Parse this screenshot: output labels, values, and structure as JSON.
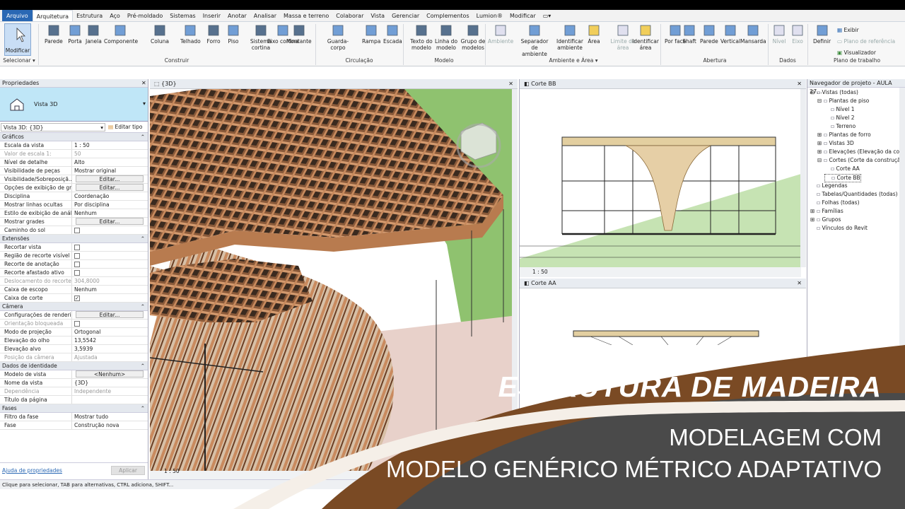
{
  "menu": {
    "tabs": [
      "Arquivo",
      "Arquitetura",
      "Estrutura",
      "Aço",
      "Pré-moldado",
      "Sistemas",
      "Inserir",
      "Anotar",
      "Analisar",
      "Massa e terreno",
      "Colaborar",
      "Vista",
      "Gerenciar",
      "Complementos",
      "Lumion®",
      "Modificar"
    ],
    "extra_icon": "view-dropdown-icon"
  },
  "ribbon": {
    "selecionar_group": "Selecionar ▾",
    "modificar": "Modificar",
    "construir_group": "Construir",
    "construir": [
      "Parede",
      "Porta",
      "Janela",
      "Componente",
      "Coluna",
      "Telhado",
      "Forro",
      "Piso",
      "Sistema cortina",
      "Eixo cortina",
      "Montante"
    ],
    "circulacao_group": "Circulação",
    "circulacao": [
      "Guarda-corpo",
      "Rampa",
      "Escada"
    ],
    "modelo_group": "Modelo",
    "modelo": [
      "Texto do modelo",
      "Linha do modelo",
      "Grupo de modelos"
    ],
    "ambiente_group": "Ambiente e Área ▾",
    "ambiente": [
      "Ambiente",
      "Separador de ambiente",
      "Identificar ambiente",
      "Área",
      "Limite de área",
      "Identificar área"
    ],
    "abertura_group": "Abertura",
    "abertura": [
      "Por face",
      "Shaft",
      "Parede",
      "Vertical",
      "Mansarda"
    ],
    "dados_group": "Dados",
    "dados": [
      "Nível",
      "Eixo"
    ],
    "plano_group": "Plano de trabalho",
    "definir": "Definir",
    "plano_side": [
      "Exibir",
      "Plano de referência",
      "Visualizador"
    ]
  },
  "properties": {
    "header": "Propriedades",
    "type_name": "Vista 3D",
    "selector": "Vista 3D: {3D}",
    "edit_type": "Editar tipo",
    "sections": {
      "graficos": "Gráficos",
      "extensoes": "Extensões",
      "camera": "Câmera",
      "identidade": "Dados de identidade",
      "fases": "Fases"
    },
    "graficos": [
      {
        "k": "Escala da vista",
        "v": "1 : 50"
      },
      {
        "k": "Valor de escala    1:",
        "v": "50"
      },
      {
        "k": "Nível de detalhe",
        "v": "Alto"
      },
      {
        "k": "Visibilidade de peças",
        "v": "Mostrar original"
      },
      {
        "k": "Visibilidade/Sobreposiçã...",
        "v": "Editar..."
      },
      {
        "k": "Opções de exibição de gr...",
        "v": "Editar..."
      },
      {
        "k": "Disciplina",
        "v": "Coordenação"
      },
      {
        "k": "Mostrar linhas ocultas",
        "v": "Por disciplina"
      },
      {
        "k": "Estilo de exibição de anál...",
        "v": "Nenhum"
      },
      {
        "k": "Mostrar grades",
        "v": "Editar..."
      },
      {
        "k": "Caminho do sol",
        "v": ""
      }
    ],
    "extensoes": [
      {
        "k": "Recortar vista",
        "v": ""
      },
      {
        "k": "Região de recorte visível",
        "v": ""
      },
      {
        "k": "Recorte de anotação",
        "v": ""
      },
      {
        "k": "Recorte afastado ativo",
        "v": ""
      },
      {
        "k": "Deslocamento do recorte...",
        "v": "304,8000"
      },
      {
        "k": "Caixa de escopo",
        "v": "Nenhum"
      },
      {
        "k": "Caixa de corte",
        "v": "✓"
      }
    ],
    "camera": [
      {
        "k": "Configurações de renderi...",
        "v": "Editar..."
      },
      {
        "k": "Orientação bloqueada",
        "v": ""
      },
      {
        "k": "Modo de projeção",
        "v": "Ortogonal"
      },
      {
        "k": "Elevação do olho",
        "v": "13,5542"
      },
      {
        "k": "Elevação alvo",
        "v": "3,5939"
      },
      {
        "k": "Posição da câmera",
        "v": "Ajustada"
      }
    ],
    "identidade": [
      {
        "k": "Modelo de vista",
        "v": "<Nenhum>"
      },
      {
        "k": "Nome da vista",
        "v": "{3D}"
      },
      {
        "k": "Dependência",
        "v": "Independente"
      },
      {
        "k": "Título da página",
        "v": ""
      }
    ],
    "fases": [
      {
        "k": "Filtro da fase",
        "v": "Mostrar tudo"
      },
      {
        "k": "Fase",
        "v": "Construção nova"
      }
    ],
    "help_link": "Ajuda de propriedades",
    "apply": "Aplicar"
  },
  "views": {
    "v3d_tab": "{3D}",
    "cortebb_tab": "Corte BB",
    "corteaa_tab": "Corte AA",
    "scale": "1 : 50",
    "accent_wood": "#c98a5e",
    "accent_grass": "#8fc26f"
  },
  "navigator": {
    "title": "Navegador de projeto - AULA 27...",
    "items": [
      {
        "label": "Vistas (todas)",
        "indent": 0,
        "toggle": "⊟"
      },
      {
        "label": "Plantas de piso",
        "indent": 1,
        "toggle": "⊟"
      },
      {
        "label": "Nível 1",
        "indent": 2,
        "toggle": ""
      },
      {
        "label": "Nível 2",
        "indent": 2,
        "toggle": ""
      },
      {
        "label": "Terreno",
        "indent": 2,
        "toggle": ""
      },
      {
        "label": "Plantas de forro",
        "indent": 1,
        "toggle": "⊞"
      },
      {
        "label": "Vistas 3D",
        "indent": 1,
        "toggle": "⊞"
      },
      {
        "label": "Elevações (Elevação da constru",
        "indent": 1,
        "toggle": "⊞"
      },
      {
        "label": "Cortes (Corte da construção)",
        "indent": 1,
        "toggle": "⊟"
      },
      {
        "label": "Corte AA",
        "indent": 2,
        "toggle": ""
      },
      {
        "label": "Corte BB",
        "indent": 2,
        "toggle": "",
        "selected": true
      },
      {
        "label": "Legendas",
        "indent": 0,
        "toggle": ""
      },
      {
        "label": "Tabelas/Quantidades (todas)",
        "indent": 0,
        "toggle": ""
      },
      {
        "label": "Folhas (todas)",
        "indent": 0,
        "toggle": ""
      },
      {
        "label": "Famílias",
        "indent": 0,
        "toggle": "⊞"
      },
      {
        "label": "Grupos",
        "indent": 0,
        "toggle": "⊞"
      },
      {
        "label": "Vínculos do Revit",
        "indent": 0,
        "toggle": ""
      }
    ]
  },
  "status": "Clique para selecionar, TAB para alternativas, CTRL adiciona, SHIFT...",
  "banner": {
    "title": "ESTRUTURA DE MADEIRA",
    "sub1": "MODELAGEM COM",
    "sub2": "MODELO GENÉRICO MÉTRICO ADAPTATIVO",
    "brown": "#7a4a24",
    "grey": "#4a4a4a"
  }
}
